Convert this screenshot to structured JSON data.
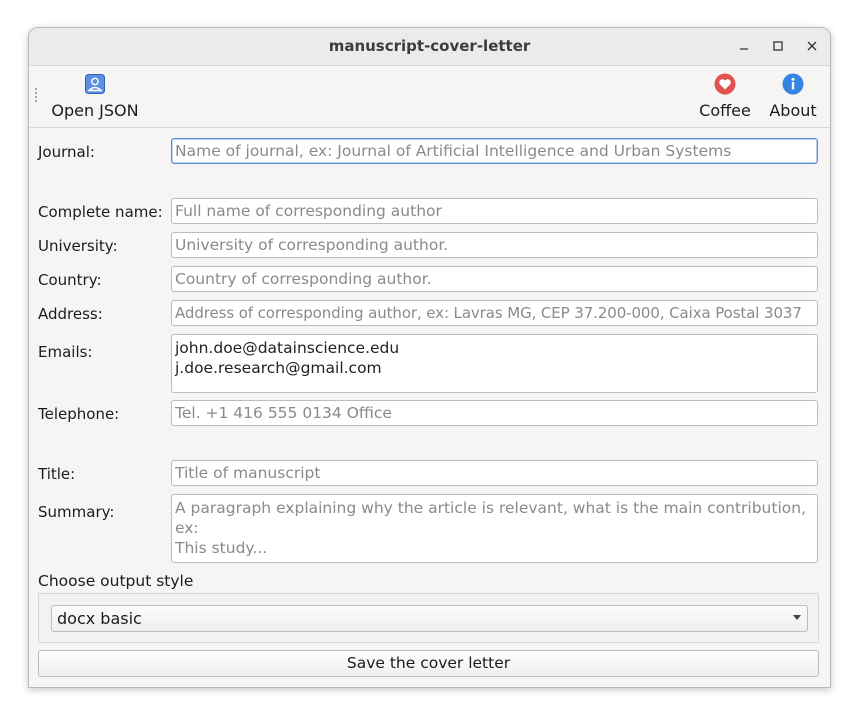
{
  "window": {
    "title": "manuscript-cover-letter"
  },
  "toolbar": {
    "open_json": {
      "label": "Open JSON",
      "icon": "person-card-icon"
    },
    "coffee": {
      "label": "Coffee",
      "icon": "heart-icon"
    },
    "about": {
      "label": "About",
      "icon": "info-icon"
    }
  },
  "form": {
    "journal": {
      "label": "Journal:",
      "value": "",
      "placeholder": "Name of journal, ex: Journal of Artificial Intelligence and Urban Systems"
    },
    "complete_name": {
      "label": "Complete name:",
      "value": "",
      "placeholder": "Full name of corresponding author"
    },
    "university": {
      "label": "University:",
      "value": "",
      "placeholder": "University of corresponding author."
    },
    "country": {
      "label": "Country:",
      "value": "",
      "placeholder": "Country of corresponding author."
    },
    "address": {
      "label": "Address:",
      "value": "",
      "placeholder": "Address of corresponding author, ex: Lavras MG, CEP 37.200-000, Caixa Postal 3037"
    },
    "emails": {
      "label": "Emails:",
      "value": "john.doe@datainscience.edu\nj.doe.research@gmail.com",
      "placeholder": ""
    },
    "telephone": {
      "label": "Telephone:",
      "value": "",
      "placeholder": "Tel. +1 416 555 0134 Office"
    },
    "title": {
      "label": "Title:",
      "value": "",
      "placeholder": "Title of manuscript"
    },
    "summary": {
      "label": "Summary:",
      "value": "",
      "placeholder": "A paragraph explaining why the article is relevant, what is the main contribution, ex:\nThis study..."
    }
  },
  "output": {
    "label": "Choose output style",
    "selected": "docx basic"
  },
  "save_button": {
    "label": "Save the cover letter"
  },
  "colors": {
    "accent": "#5a8ed6",
    "heart": "#e2524f",
    "info": "#3584e4"
  }
}
